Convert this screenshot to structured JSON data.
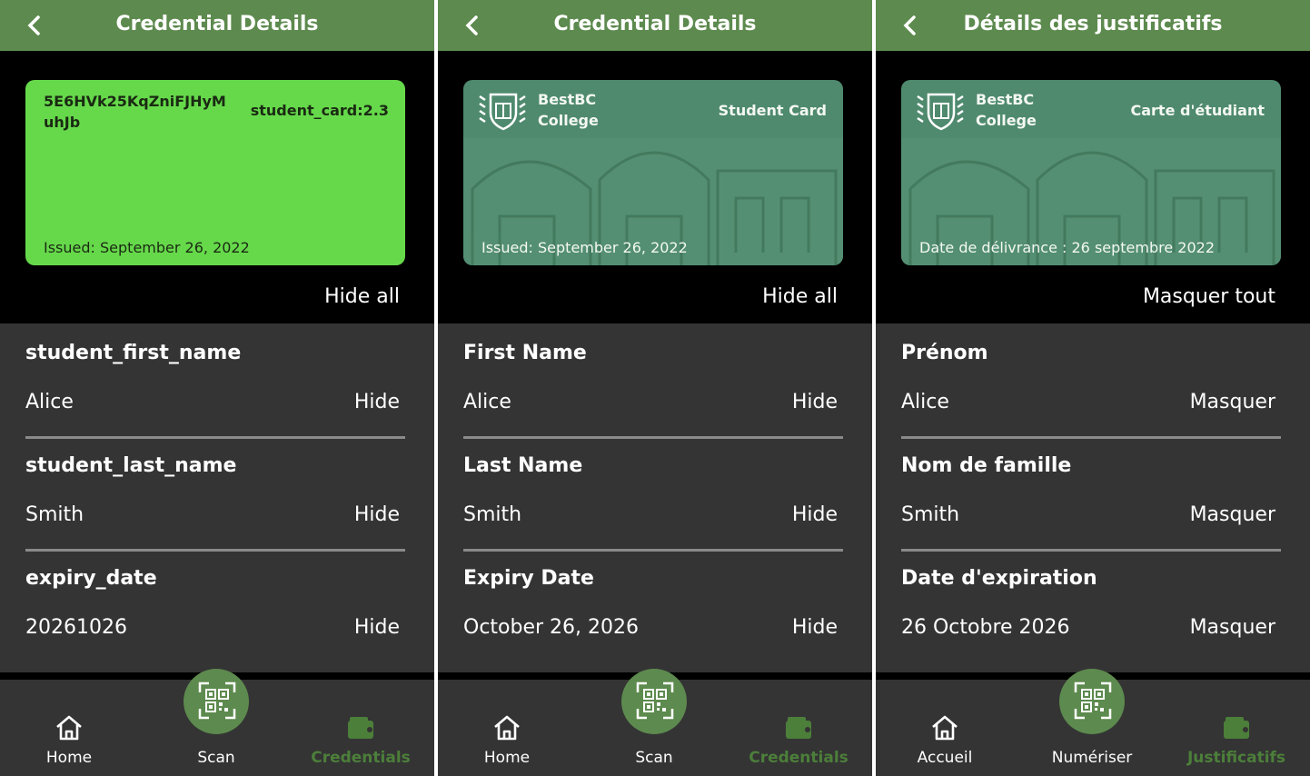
{
  "colors": {
    "header_green": "#5d8a4e",
    "card_bright_green": "#66d94b",
    "card_styled": "#4f8a6e",
    "details_bg": "#343434",
    "active_nav": "#4c7f3a"
  },
  "icons": {
    "back": "chevron-left-icon",
    "home": "home-icon",
    "scan": "qr-code-icon",
    "credentials": "wallet-icon",
    "logo": "book-shield-icon"
  },
  "panels": [
    {
      "title": "Credential Details",
      "card": {
        "id_text": "5E6HVk25KqZniFJHyMuhJb",
        "type": "student_card:2.3",
        "issued": "Issued: September 26, 2022"
      },
      "hide_all": "Hide all",
      "attributes": [
        {
          "label": "student_first_name",
          "value": "Alice",
          "action": "Hide"
        },
        {
          "label": "student_last_name",
          "value": "Smith",
          "action": "Hide"
        },
        {
          "label": "expiry_date",
          "value": "20261026",
          "action": "Hide"
        }
      ],
      "nav": {
        "home": "Home",
        "scan": "Scan",
        "credentials": "Credentials"
      }
    },
    {
      "title": "Credential Details",
      "card": {
        "school_line1": "BestBC",
        "school_line2": "College",
        "type": "Student Card",
        "issued": "Issued: September 26, 2022"
      },
      "hide_all": "Hide all",
      "attributes": [
        {
          "label": "First Name",
          "value": "Alice",
          "action": "Hide"
        },
        {
          "label": "Last Name",
          "value": "Smith",
          "action": "Hide"
        },
        {
          "label": "Expiry Date",
          "value": "October 26, 2026",
          "action": "Hide"
        }
      ],
      "nav": {
        "home": "Home",
        "scan": "Scan",
        "credentials": "Credentials"
      }
    },
    {
      "title": "Détails des justificatifs",
      "card": {
        "school_line1": "BestBC",
        "school_line2": "College",
        "type": "Carte d'étudiant",
        "issued": "Date de délivrance : 26 septembre 2022"
      },
      "hide_all": "Masquer tout",
      "attributes": [
        {
          "label": "Prénom",
          "value": "Alice",
          "action": "Masquer"
        },
        {
          "label": "Nom de famille",
          "value": "Smith",
          "action": "Masquer"
        },
        {
          "label": "Date d'expiration",
          "value": "26 Octobre 2026",
          "action": "Masquer"
        }
      ],
      "nav": {
        "home": "Accueil",
        "scan": "Numériser",
        "credentials": "Justificatifs"
      }
    }
  ]
}
